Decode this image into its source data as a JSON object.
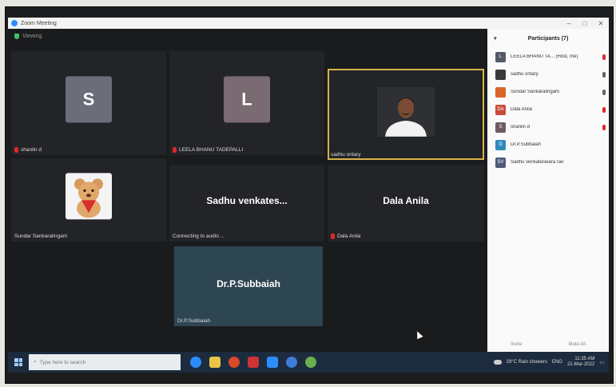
{
  "window": {
    "title": "Zoom Meeting",
    "minimize": "–",
    "maximize": "□",
    "close": "✕"
  },
  "meeting": {
    "top_info": "Viewing"
  },
  "tiles": [
    {
      "id": "tile-shanlin",
      "name": "shanlin d",
      "initial": "S",
      "avatar_color": "#6b6e78",
      "muted": true
    },
    {
      "id": "tile-leela",
      "name": "LEELA BHANU TADEPALLI",
      "initial": "L",
      "avatar_color": "#7a6a72",
      "muted": true
    },
    {
      "id": "tile-sadhu-active",
      "name": "sadhu ontary",
      "muted": false
    },
    {
      "id": "tile-sundar",
      "name": "Sundar Sankaralingam",
      "muted": false
    },
    {
      "id": "tile-sadhu-venkates",
      "name": "Sadhu venkates...",
      "status": "Connecting to audio ..."
    },
    {
      "id": "tile-dala",
      "name": "Dala Anila",
      "label": "Dala Anila",
      "muted": true
    },
    {
      "id": "tile-subbaiah",
      "name": "Dr.P.Subbaiah",
      "label": "Dr.P.Subbaiah"
    }
  ],
  "participants_panel": {
    "header": "Participants (7)",
    "items": [
      {
        "label": "LEELA BHANU TA... (Host, me)",
        "badge": "L",
        "color": "#555a66",
        "muted": true
      },
      {
        "label": "sadhu ontary",
        "badge": "",
        "color": "#3b3a38",
        "muted": false
      },
      {
        "label": "Sundar Sankaralingam",
        "badge": "",
        "color": "#d9642a",
        "muted": false
      },
      {
        "label": "Dala Anila",
        "badge": "DA",
        "color": "#c94a3a",
        "muted": true
      },
      {
        "label": "shanlin d",
        "badge": "S",
        "color": "#6f5a66",
        "muted": true
      },
      {
        "label": "Dr.P.Subbaiah",
        "badge": "D",
        "color": "#2f8ab8",
        "muted": false
      },
      {
        "label": "Sadhu venkateswara rao",
        "badge": "SV",
        "color": "#4e5b78",
        "muted": false
      }
    ],
    "footer": {
      "invite": "Invite",
      "mute_all": "Mute All"
    }
  },
  "taskbar": {
    "search_placeholder": "Type here to search",
    "weather": "29°C  Rain showers",
    "language": "ENG",
    "time": "11:35 AM",
    "date": "21-Mar-2022"
  }
}
